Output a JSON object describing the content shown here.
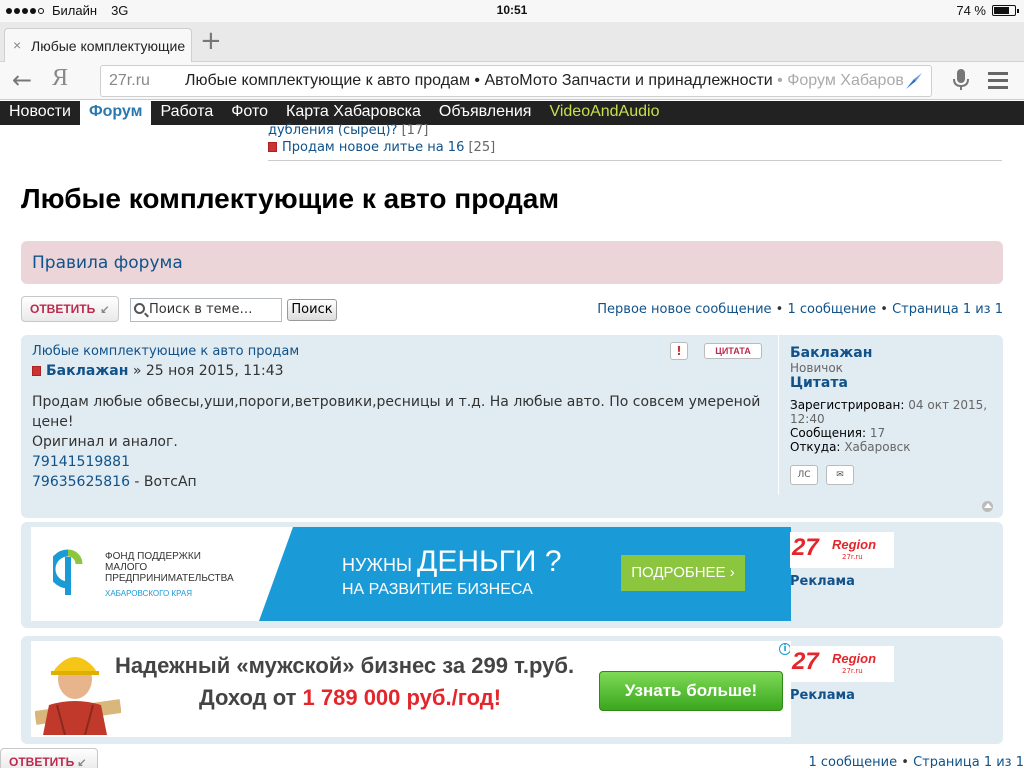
{
  "status": {
    "carrier": "Билайн",
    "network": "3G",
    "time": "10:51",
    "battery": "74 %",
    "battery_level": 0.74
  },
  "browser": {
    "tab_title": "Любые комплектующие к авто",
    "tab_close": "×",
    "new_tab": "+",
    "back": "←",
    "yandex": "Я",
    "url_domain": "27r.ru",
    "url_title": "Любые комплектующие к авто продам • АвтоМото Запчасти и принадлежности",
    "url_tail": " • Форум Хабаровск"
  },
  "nav": {
    "items": [
      "Новости",
      "Форум",
      "Работа",
      "Фото",
      "Карта Хабаровска",
      "Объявления",
      "VideoAndAudio"
    ],
    "active": "Форум"
  },
  "prev": {
    "link1": "дубления (сырец)?",
    "link1_count": "[17]",
    "link2": "Продам новое литье на 16",
    "link2_count": "[25]"
  },
  "page_title": "Любые комплектующие к авто продам",
  "rules_label": "Правила форума",
  "toolbar": {
    "reply_label": "ОТВЕТИТЬ",
    "search_placeholder": "Поиск в теме…",
    "search_button": "Поиск",
    "first_new": "Первое новое сообщение",
    "sep": " • ",
    "msg_count": "1 сообщение",
    "page": "Страница 1 из 1"
  },
  "post": {
    "title": "Любые комплектующие к авто продам",
    "warn": "!",
    "quote": "ЦИТАТА",
    "author": "Баклажан",
    "date": " » 25 ноя 2015, 11:43",
    "body_line1": "Продам любые обвесы,уши,пороги,ветровики,ресницы и т.д. На любые авто. По совсем умереной цене!",
    "body_line2": "Оригинал и аналог.",
    "phone1": "79141519881",
    "phone2": "79635625816",
    "phone2_suffix": " - ВотсАп"
  },
  "profile": {
    "name": "Баклажан",
    "rank": "Новичок",
    "rank2": "Цитата",
    "registered_label": "Зарегистрирован:",
    "registered_value": "04 окт 2015, 12:40",
    "posts_label": "Сообщения:",
    "posts_value": "17",
    "from_label": "Откуда:",
    "from_value": "Хабаровск",
    "pm_label": "ЛС",
    "email_label": "✉"
  },
  "ad1": {
    "fund_line1": "ФОНД ПОДДЕРЖКИ",
    "fund_line2": "МАЛОГО",
    "fund_line3": "ПРЕДПРИНИМАТЕЛЬСТВА",
    "fund_sub": "ХАБАРОВСКОГО КРАЯ",
    "headline_a": "НУЖНЫ ",
    "headline_b": "ДЕНЬГИ ?",
    "subline": "НА РАЗВИТИЕ БИЗНЕСА",
    "more": "ПОДРОБНЕЕ ›"
  },
  "ad2": {
    "line1": "Надежный «мужской» бизнес за 299 т.руб.",
    "line2_a": "Доход от ",
    "line2_b": "1 789 000 руб./год!",
    "button": "Узнать больше!",
    "info": "i"
  },
  "region": {
    "num": "27",
    "word": "Region",
    "site": "27r.ru",
    "ad_label": "Реклама"
  },
  "bottom": {
    "reply_label": "ОТВЕТИТЬ",
    "msg_count": "1 сообщение",
    "sep": " • ",
    "page": "Страница 1 из 1"
  },
  "colors": {
    "link": "#105289",
    "nav_bg": "#222222",
    "post_bg": "#e1ebf2",
    "rules_bg": "#ecd5d8",
    "reply_red": "#bc2a4d"
  }
}
